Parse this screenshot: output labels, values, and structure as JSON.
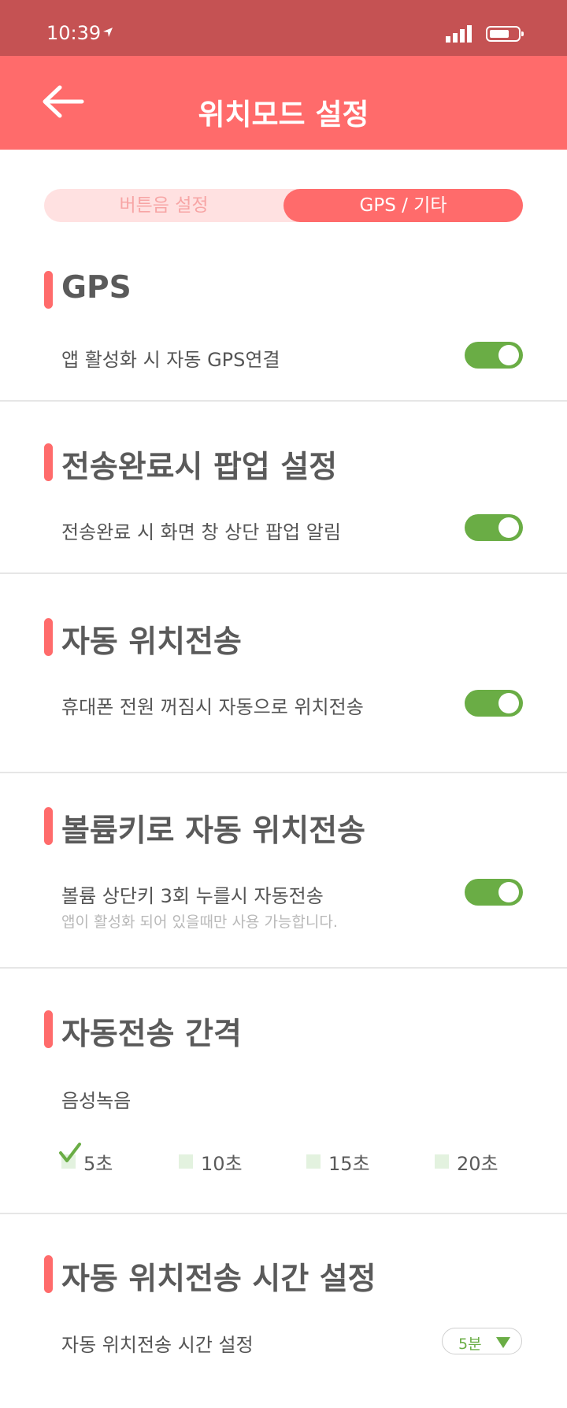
{
  "status_bar": {
    "time": "10:39"
  },
  "header": {
    "title": "위치모드 설정"
  },
  "tabs": {
    "left": "버튼음 설정",
    "right": "GPS / 기타"
  },
  "sections": [
    {
      "title": "GPS",
      "row": "앱 활성화 시 자동 GPS연결",
      "toggle": "on"
    },
    {
      "title": "전송완료시 팝업 설정",
      "row": "전송완료 시 화면 창 상단 팝업 알림",
      "toggle": "on"
    },
    {
      "title": "자동 위치전송",
      "row": "휴대폰 전원 꺼짐시 자동으로 위치전송",
      "toggle": "on"
    },
    {
      "title": "볼륨키로 자동 위치전송",
      "row": "볼륨 상단키 3회 누를시 자동전송",
      "sub": "앱이 활성화 되어 있을때만 사용 가능합니다.",
      "toggle": "on"
    },
    {
      "title": "자동전송 간격",
      "row": "음성녹음",
      "options": [
        "5초",
        "10초",
        "15초",
        "20초"
      ],
      "selected": "5초"
    },
    {
      "title": "자동 위치전송 시간 설정",
      "row": "자동 위치전송 시간 설정",
      "select_value": "5분"
    }
  ],
  "colors": {
    "accent": "#ff6b6b",
    "status_bar": "#c55253",
    "toggle_on": "#6aad45",
    "tab_inactive_bg": "#ffe1e1"
  }
}
